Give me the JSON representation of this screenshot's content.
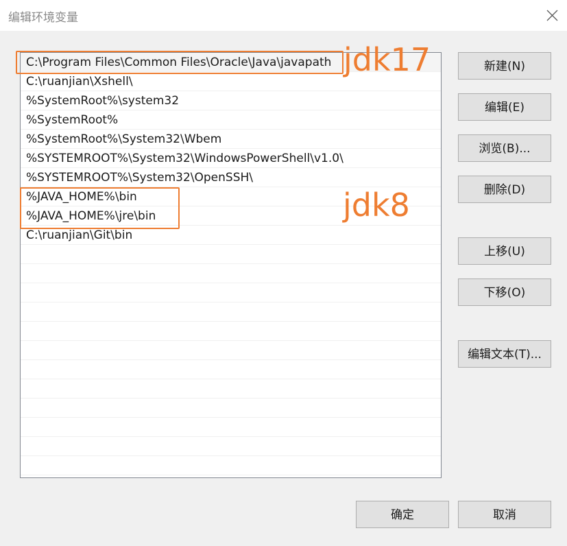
{
  "window": {
    "title": "编辑环境变量"
  },
  "list": {
    "items": [
      "C:\\Program Files\\Common Files\\Oracle\\Java\\javapath",
      "C:\\ruanjian\\Xshell\\",
      "%SystemRoot%\\system32",
      "%SystemRoot%",
      "%SystemRoot%\\System32\\Wbem",
      "%SYSTEMROOT%\\System32\\WindowsPowerShell\\v1.0\\",
      "%SYSTEMROOT%\\System32\\OpenSSH\\",
      "%JAVA_HOME%\\bin",
      "%JAVA_HOME%\\jre\\bin",
      "C:\\ruanjian\\Git\\bin"
    ],
    "empty_rows": 12
  },
  "annotations": {
    "jdk17": "jdk17",
    "jdk8": "jdk8"
  },
  "buttons": {
    "new": "新建(N)",
    "edit": "编辑(E)",
    "browse": "浏览(B)...",
    "delete": "删除(D)",
    "move_up": "上移(U)",
    "move_down": "下移(O)",
    "edit_text": "编辑文本(T)...",
    "ok": "确定",
    "cancel": "取消"
  },
  "colors": {
    "annotation": "#ee7d31",
    "button_bg": "#e1e1e1",
    "dialog_bg": "#f0f0f0"
  }
}
